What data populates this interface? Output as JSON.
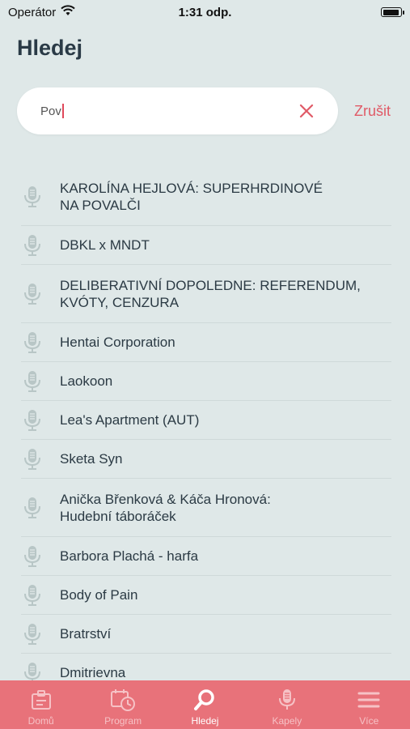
{
  "status_bar": {
    "carrier": "Operátor",
    "time": "1:31 odp."
  },
  "page": {
    "title": "Hledej"
  },
  "search": {
    "value": "Pov",
    "cancel_label": "Zrušit"
  },
  "results": [
    {
      "label": "KAROLÍNA HEJLOVÁ: SUPERHRDINOVÉ\nNA POVALČI"
    },
    {
      "label": "DBKL x MNDT"
    },
    {
      "label": "DELIBERATIVNÍ DOPOLEDNE: REFERENDUM,\nKVÓTY, CENZURA"
    },
    {
      "label": "Hentai Corporation"
    },
    {
      "label": "Laokoon"
    },
    {
      "label": "Lea's Apartment (AUT)"
    },
    {
      "label": "Sketa Syn"
    },
    {
      "label": "Anička Břenková & Káča Hronová:\nHudební táboráček"
    },
    {
      "label": "Barbora Plachá - harfa"
    },
    {
      "label": "Body of Pain"
    },
    {
      "label": "Bratrství"
    },
    {
      "label": "Dmitrievna"
    }
  ],
  "tabs": [
    {
      "label": "Domů",
      "icon": "home-icon",
      "active": false
    },
    {
      "label": "Program",
      "icon": "calendar-clock-icon",
      "active": false
    },
    {
      "label": "Hledej",
      "icon": "search-icon",
      "active": true
    },
    {
      "label": "Kapely",
      "icon": "microphone-icon",
      "active": false
    },
    {
      "label": "Více",
      "icon": "menu-icon",
      "active": false
    }
  ],
  "colors": {
    "background": "#dfe8e8",
    "accent": "#e05a67",
    "tab_bar": "#e8727a"
  }
}
